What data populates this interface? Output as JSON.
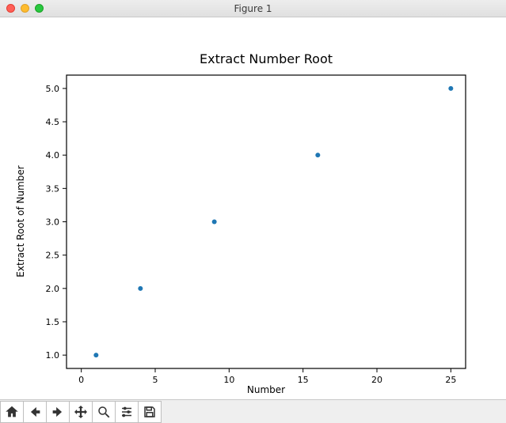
{
  "window": {
    "title": "Figure 1"
  },
  "toolbar": {
    "home": "Home",
    "back": "Back",
    "forward": "Forward",
    "pan": "Pan",
    "zoom": "Zoom",
    "configure": "Configure subplots",
    "save": "Save"
  },
  "chart_data": {
    "type": "scatter",
    "title": "Extract Number Root",
    "xlabel": "Number",
    "ylabel": "Extract Root of Number",
    "x_ticks": [
      0,
      5,
      10,
      15,
      20,
      25
    ],
    "y_ticks": [
      1.0,
      1.5,
      2.0,
      2.5,
      3.0,
      3.5,
      4.0,
      4.5,
      5.0
    ],
    "xlim": [
      -1,
      26
    ],
    "ylim": [
      0.8,
      5.2
    ],
    "x": [
      1,
      4,
      9,
      16,
      25
    ],
    "y": [
      1.0,
      2.0,
      3.0,
      4.0,
      5.0
    ]
  }
}
